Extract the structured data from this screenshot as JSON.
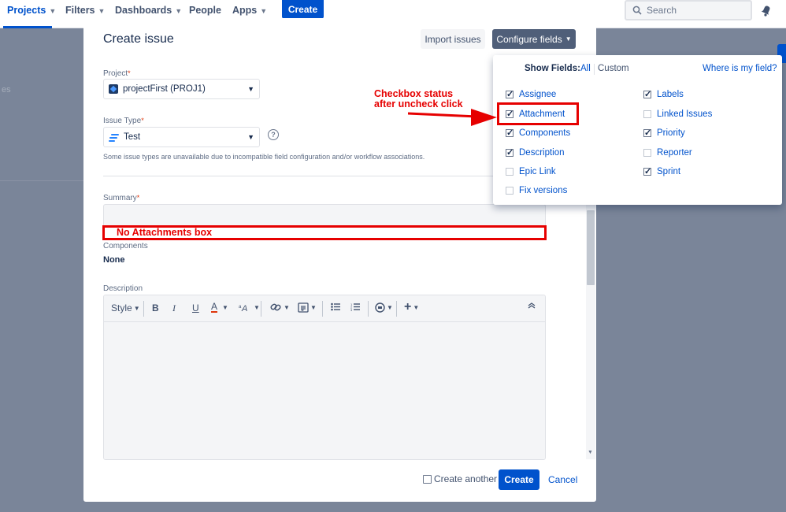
{
  "nav": {
    "projects": "Projects",
    "filters": "Filters",
    "dashboards": "Dashboards",
    "people": "People",
    "apps": "Apps",
    "create": "Create",
    "search_placeholder": "Search"
  },
  "background": {
    "partial_text": "es"
  },
  "modal": {
    "title": "Create issue",
    "import_label": "Import issues",
    "configure_label": "Configure fields",
    "project_label": "Project",
    "project_value": "projectFirst (PROJ1)",
    "issuetype_label": "Issue Type",
    "issuetype_value": "Test",
    "help_glyph": "?",
    "issuetype_note": "Some issue types are unavailable due to incompatible field configuration and/or workflow associations.",
    "summary_label": "Summary",
    "components_label": "Components",
    "components_value": "None",
    "description_label": "Description",
    "toolbar": {
      "style": "Style",
      "bold": "B",
      "italic": "I",
      "underline": "U",
      "color": "A"
    },
    "create_another": "Create another",
    "create_button": "Create",
    "cancel_button": "Cancel"
  },
  "dropdown": {
    "show_fields": "Show Fields:",
    "all": "All",
    "custom": "Custom",
    "where": "Where is my field?",
    "left_items": [
      {
        "label": "Assignee",
        "checked": true
      },
      {
        "label": "Attachment",
        "checked": true
      },
      {
        "label": "Components",
        "checked": true
      },
      {
        "label": "Description",
        "checked": true
      },
      {
        "label": "Epic Link",
        "checked": false
      },
      {
        "label": "Fix versions",
        "checked": false
      }
    ],
    "right_items": [
      {
        "label": "Labels",
        "checked": true
      },
      {
        "label": "Linked Issues",
        "checked": false
      },
      {
        "label": "Priority",
        "checked": true
      },
      {
        "label": "Reporter",
        "checked": false
      },
      {
        "label": "Sprint",
        "checked": true
      }
    ]
  },
  "annotations": {
    "checkbox_note_line1": "Checkbox status",
    "checkbox_note_line2": "after uncheck click",
    "no_attachments": "No Attachments box"
  },
  "colors": {
    "brand": "#0052cc",
    "annotation": "#e60000",
    "overlay": "#505f79"
  }
}
